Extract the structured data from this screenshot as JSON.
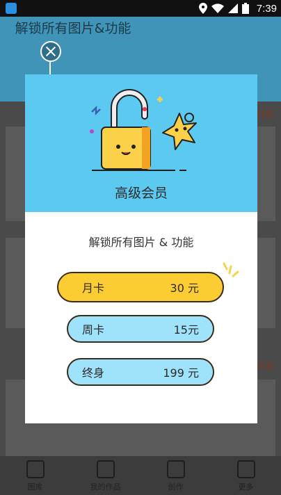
{
  "status_bar": {
    "time": "7:39"
  },
  "background": {
    "banner_title": "解锁所有图片&功能",
    "section_all_label": "全部",
    "tabs": [
      {
        "label": "图库"
      },
      {
        "label": "我的作品"
      },
      {
        "label": "创作"
      },
      {
        "label": "更多"
      }
    ]
  },
  "dialog": {
    "title": "高级会员",
    "subtitle": "解锁所有图片 & 功能",
    "plans": [
      {
        "name": "月卡",
        "price": "30 元"
      },
      {
        "name": "周卡",
        "price": "15元"
      },
      {
        "name": "终身",
        "price": "199 元"
      }
    ]
  },
  "colors": {
    "header_bg": "#5ccaf0",
    "month_plan_bg": "#fccd32",
    "plan_bg": "#9fe3fb"
  }
}
